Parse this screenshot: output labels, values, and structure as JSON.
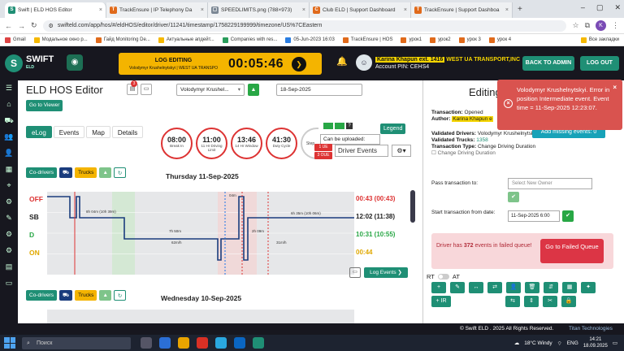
{
  "browser": {
    "tabs": [
      {
        "title": "Swift | ELD HOS Editor",
        "color": "#1f8f75",
        "active": true
      },
      {
        "title": "TrackEnsure | IP Telephony Da",
        "color": "#e06a1b",
        "active": false
      },
      {
        "title": "SPEEDLIMITS.png (788×973)",
        "color": "#7b8794",
        "active": false
      },
      {
        "title": "Club ELD | Support Dashboard",
        "color": "#e06a1b",
        "active": false
      },
      {
        "title": "TrackEnsure | Support Dashboa",
        "color": "#e06a1b",
        "active": false
      }
    ],
    "url": "swifteld.com/app/hos/#/eldHOS/editor/driver/11241/timestamp/1758229199999/timezone/US%7CEastern",
    "bookmarks": [
      "Gmail",
      "Модальное окно p...",
      "Гайд Monitoring De...",
      "Актуальные апдейт...",
      "Companies with res...",
      "05-Jun-2023 16:03",
      "TrackEnsure | HOS",
      "урок1",
      "урок2",
      "урок 3",
      "урок 4"
    ],
    "bookmarks_all": "Все закладки",
    "profile_initial": "K"
  },
  "header": {
    "logo_text": "SWIFT",
    "logo_sub": "ELD",
    "edit_title": "LOG EDITING",
    "edit_sub": "Volodymyr Krushelnytskyi | WEST UA TRANSPO",
    "timer": "00:05:46",
    "user_name": "Karina Khapun ext. 1416",
    "company": "WEST UA TRANSPORT,INC",
    "account": "Account PIN: CEHS4",
    "back_to_admin": "BACK TO ADMIN",
    "logout": "LOG OUT"
  },
  "editor": {
    "title": "ELD HOS Editor",
    "badge_count": "3",
    "driver_select": "Volodymyr Krushel...",
    "date": "18-Sep-2025",
    "go_to_viewer": "Go to Viewer",
    "tabs": [
      "eLog",
      "Events",
      "Map",
      "Details"
    ],
    "clocks": [
      {
        "value": "08:00",
        "label": "Break In"
      },
      {
        "value": "11:00",
        "label": "11 Hr Driving Limit"
      },
      {
        "value": "13:46",
        "label": "14 Hr Window"
      },
      {
        "value": "41:30",
        "label": "Duty Cycle"
      }
    ],
    "clock_cut": "Step",
    "can_be_uploaded": "Can be uploaded:",
    "legend": "Legend",
    "driver_events": "Driver Events",
    "red_badges": [
      "1 UE",
      "3 OUE"
    ],
    "toolbar": {
      "co_drivers": "Co-drivers",
      "trucks": "Trucks"
    },
    "day1": {
      "header": "Thursday 11-Sep-2025",
      "rows": [
        "OFF",
        "SB",
        "D",
        "ON"
      ],
      "totals": [
        "00:43 (00:43)",
        "12:02 (11:38)",
        "10:31 (10:55)",
        "00:44"
      ],
      "segment_labels": [
        "8h 04m (10h 39m)",
        "7h 50m",
        "62m/h",
        "6h 35m (10h 06m)",
        "2h 09m",
        "31m/h",
        "04m"
      ]
    },
    "log_events": "Log Events",
    "day2": {
      "header": "Wednesday 10-Sep-2025"
    }
  },
  "panel": {
    "title": "Editing",
    "transaction": "Opened",
    "author": "Karina Khapun e",
    "add_missing": "Add missing events: 0",
    "validated_drivers": "Volodymyr Krushelnytskyi",
    "validated_trucks": "1358",
    "transaction_type": "Change Driving Duration",
    "change_driving_duration": "Change Driving Duration",
    "pass_label": "Pass transaction to:",
    "owner_placeholder": "Select New Owner",
    "start_label": "Start transaction from date:",
    "start_date": "11-Sep-2025 6:00",
    "fail_text_pre": "Driver has",
    "fail_count": "372",
    "fail_text_post": "events in failed queue!",
    "go_failed": "Go to Failed Queue",
    "rt": "RT",
    "at": "AT"
  },
  "toast": {
    "message": "Volodymyr Krushelnytskyi. Error in position Intermediate event. Event time = 11-Sep-2025 12:23:07."
  },
  "footer": {
    "copyright": "© Swift ELD . 2025 All Rights Reserved.",
    "powered": "Titan Technologies"
  },
  "taskbar": {
    "search": "Поиск",
    "weather": "18°C Windy",
    "lang": "ENG",
    "time": "14:21",
    "date": "18.09.2025"
  }
}
